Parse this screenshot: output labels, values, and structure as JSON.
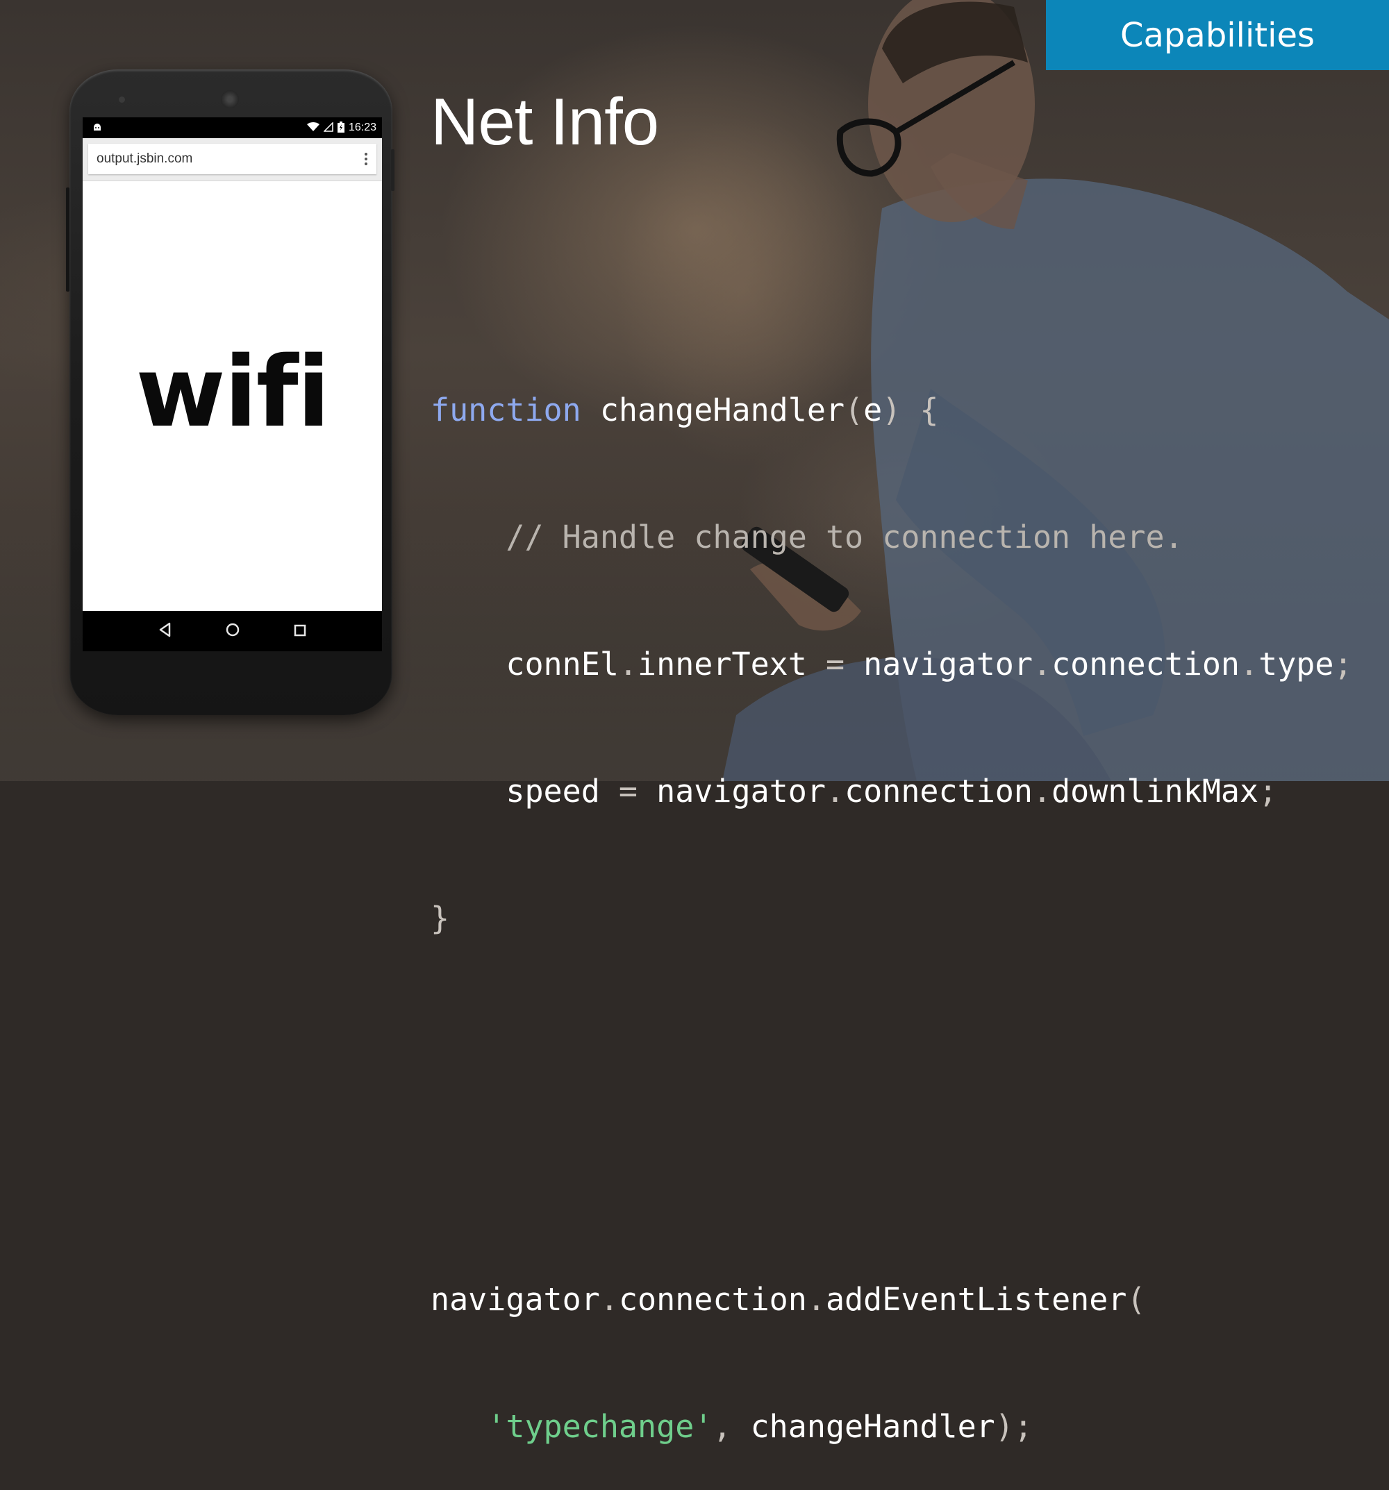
{
  "badge": {
    "label": "Capabilities",
    "color": "#0c86b9"
  },
  "title": "Net Info",
  "code": {
    "line1": {
      "kw": "function",
      "rest1": " changeHandler",
      "p1": "(",
      "arg": "e",
      "p2": ") {"
    },
    "line2": {
      "indent": "    ",
      "comment": "// Handle change to connection here."
    },
    "line3": {
      "indent": "    ",
      "a": "connEl",
      "d1": ".",
      "b": "innerText",
      "eq": " = ",
      "c": "navigator",
      "d2": ".",
      "e": "connection",
      "d3": ".",
      "f": "type",
      "semi": ";"
    },
    "line4": {
      "indent": "    ",
      "a": "speed",
      "eq": " = ",
      "b": "navigator",
      "d1": ".",
      "c": "connection",
      "d2": ".",
      "e": "downlinkMax",
      "semi": ";"
    },
    "line5": {
      "brace": "}"
    },
    "line6": {
      "a": "navigator",
      "d1": ".",
      "b": "connection",
      "d2": ".",
      "c": "addEventListener",
      "p": "("
    },
    "line7": {
      "indent": "   ",
      "str": "'typechange'",
      "comma": ", ",
      "fn": "changeHandler",
      "end": ");"
    }
  },
  "phone": {
    "status_time": "16:23",
    "url": "output.jsbin.com",
    "page_text": "wifi",
    "icons": {
      "status_left": "android-icon",
      "wifi": "wifi-signal-icon",
      "cell": "cell-signal-icon",
      "battery": "battery-icon",
      "menu": "overflow-menu-icon",
      "back": "back-icon",
      "home": "home-icon",
      "recents": "recents-icon"
    }
  }
}
